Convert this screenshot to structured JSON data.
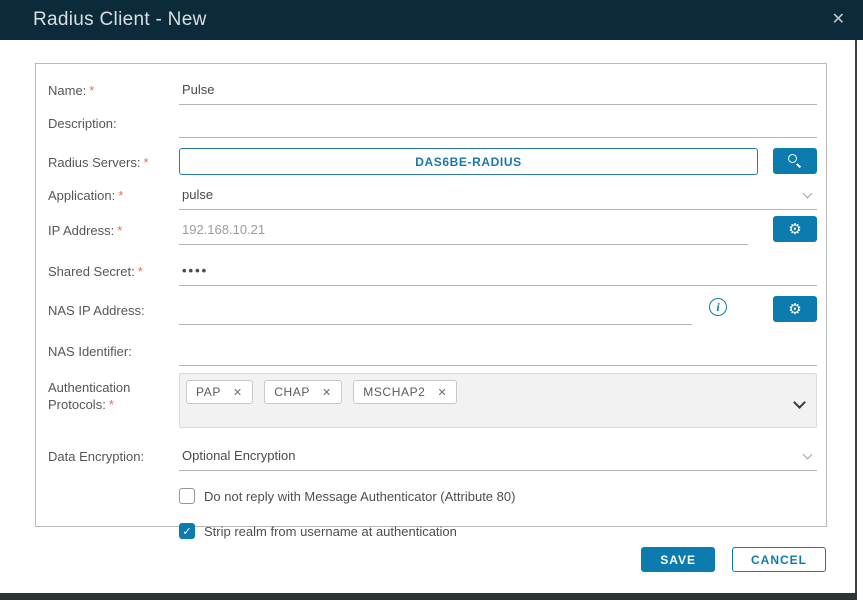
{
  "window": {
    "title": "Radius Client - New"
  },
  "icons": {
    "close": "✕",
    "gear": "⚙",
    "info": "i",
    "check": "✓",
    "chip_remove": "✕"
  },
  "colors": {
    "header_bg": "#0c2b3a",
    "accent_blue": "#0b7cad",
    "link_blue": "#1878a8",
    "required_red": "#ee6a5f"
  },
  "form": {
    "required_marker": "*",
    "fields": {
      "name": {
        "label": "Name:",
        "value": "Pulse"
      },
      "description": {
        "label": "Description:",
        "value": ""
      },
      "radius_servers": {
        "label": "Radius Servers:",
        "value": "DAS6BE-RADIUS"
      },
      "application": {
        "label": "Application:",
        "value": "pulse"
      },
      "ip_address": {
        "label": "IP Address:",
        "placeholder": "192.168.10.21"
      },
      "shared_secret": {
        "label": "Shared Secret:",
        "value": "••••"
      },
      "nas_ip_address": {
        "label": "NAS IP Address:",
        "value": ""
      },
      "nas_identifier": {
        "label": "NAS Identifier:",
        "value": ""
      },
      "auth_protocols": {
        "label": "Authentication Protocols:",
        "chips": [
          "PAP",
          "CHAP",
          "MSCHAP2"
        ]
      },
      "data_encryption": {
        "label": "Data Encryption:",
        "value": "Optional Encryption"
      },
      "attr80": {
        "label": "Do not reply with Message Authenticator (Attribute 80)",
        "checked": false
      },
      "strip_realm": {
        "label": "Strip realm from username at authentication",
        "checked": true
      }
    }
  },
  "buttons": {
    "save": "SAVE",
    "cancel": "CANCEL"
  }
}
